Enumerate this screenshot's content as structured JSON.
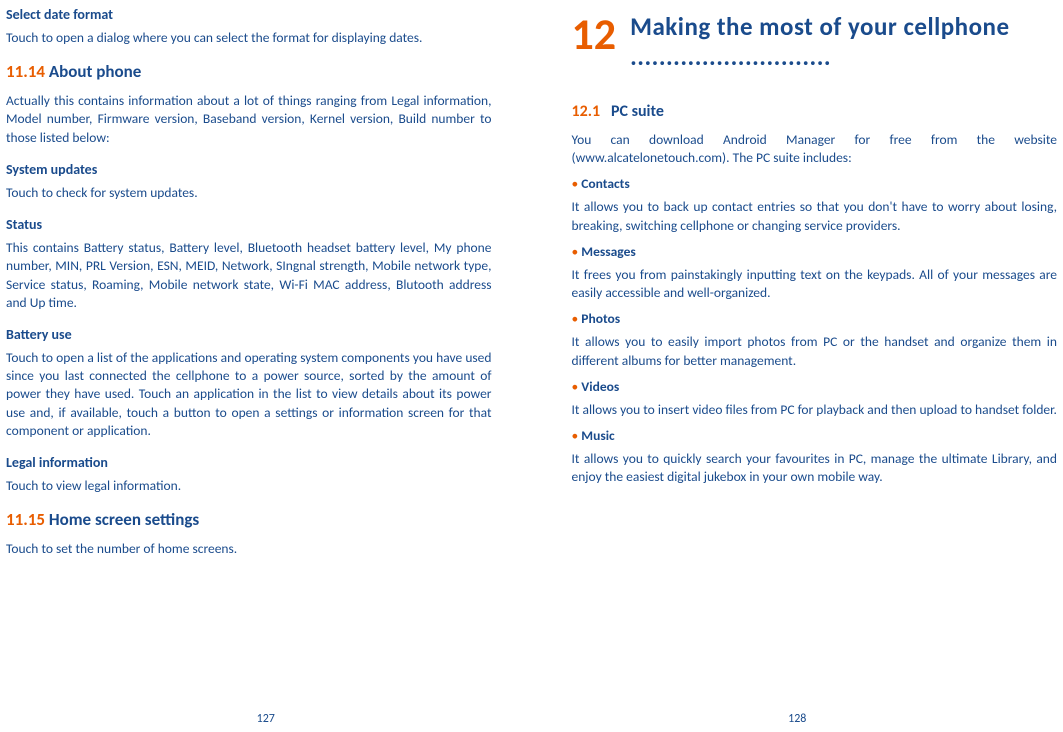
{
  "left": {
    "h_select_date": "Select date format",
    "p_select_date": "Touch to open a dialog where you can select the format for displaying dates.",
    "sec_1114_num": "11.14",
    "sec_1114_title": " About phone",
    "p_about": "Actually this contains information about a lot of things ranging from Legal information, Model number, Firmware version, Baseband version, Kernel version, Build number to those listed below:",
    "h_sysupd": "System updates",
    "p_sysupd": "Touch to check for system updates.",
    "h_status": "Status",
    "p_status": "This contains Battery status, Battery level, Bluetooth headset battery level, My phone number, MIN, PRL Version, ESN, MEID, Network, SIngnal strength, Mobile network type, Service status, Roaming, Mobile network state, Wi-Fi MAC address, Blutooth address and Up time.",
    "h_battery": "Battery use",
    "p_battery": "Touch to open a list of the applications and operating system components you have used since you last connected the cellphone to a power source, sorted by the amount of power they have used. Touch an application in the list to view details about its power use and, if available, touch a button to open a settings or information screen for that component or application.",
    "h_legal": "Legal information",
    "p_legal": "Touch to view legal information.",
    "sec_1115_num": "11.15",
    "sec_1115_title": " Home screen settings",
    "p_home": "Touch to set the number of home screens.",
    "page_num": "127"
  },
  "right": {
    "chapter_num": "12",
    "chapter_title": "Making the most of your cellphone ............................",
    "sec_121_num": "12.1",
    "sec_121_title": "PC suite",
    "p_intro": "You can download Android Manager for free from the website (www.alcatelonetouch.com). The PC suite includes:",
    "b_contacts": "Contacts",
    "p_contacts": "It allows you to back up contact entries so that you don't have to worry about losing, breaking, switching cellphone or changing service providers.",
    "b_messages": "Messages",
    "p_messages": "It frees you from painstakingly inputting text on the keypads. All of your messages are easily accessible and well-organized.",
    "b_photos": "Photos",
    "p_photos": "It allows you to easily import photos from PC or the handset and organize them in different albums for better management.",
    "b_videos": "Videos",
    "p_videos": "It allows you to insert video files from PC for playback and then upload to handset folder.",
    "b_music": "Music",
    "p_music": "It allows you to quickly search your favourites in PC, manage the ultimate Library, and enjoy the easiest digital jukebox in your own mobile way.",
    "page_num": "128"
  }
}
